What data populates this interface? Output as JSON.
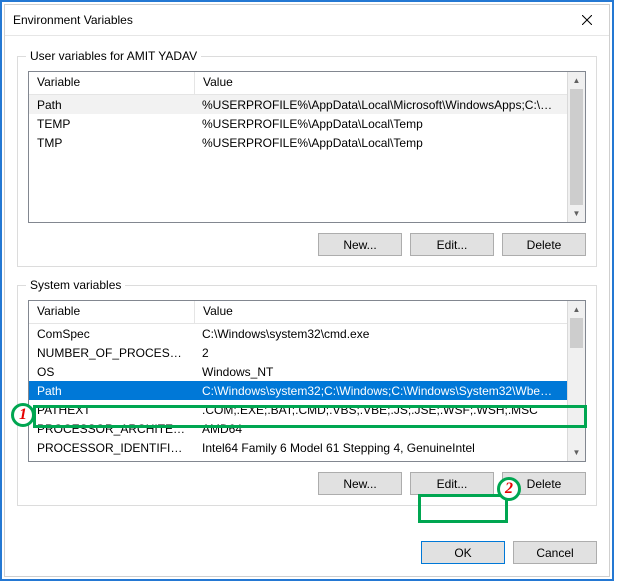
{
  "window": {
    "title": "Environment Variables"
  },
  "user_box": {
    "legend": "User variables for AMIT YADAV",
    "headers": {
      "name": "Variable",
      "value": "Value"
    },
    "rows": [
      {
        "name": "Path",
        "value": "%USERPROFILE%\\AppData\\Local\\Microsoft\\WindowsApps;C:\\Prog..."
      },
      {
        "name": "TEMP",
        "value": "%USERPROFILE%\\AppData\\Local\\Temp"
      },
      {
        "name": "TMP",
        "value": "%USERPROFILE%\\AppData\\Local\\Temp"
      }
    ],
    "buttons": {
      "new": "New...",
      "edit": "Edit...",
      "delete": "Delete"
    }
  },
  "system_box": {
    "legend": "System variables",
    "headers": {
      "name": "Variable",
      "value": "Value"
    },
    "rows": [
      {
        "name": "ComSpec",
        "value": "C:\\Windows\\system32\\cmd.exe"
      },
      {
        "name": "NUMBER_OF_PROCESSORS",
        "value": "2"
      },
      {
        "name": "OS",
        "value": "Windows_NT"
      },
      {
        "name": "Path",
        "value": "C:\\Windows\\system32;C:\\Windows;C:\\Windows\\System32\\Wbem;..."
      },
      {
        "name": "PATHEXT",
        "value": ".COM;.EXE;.BAT;.CMD;.VBS;.VBE;.JS;.JSE;.WSF;.WSH;.MSC"
      },
      {
        "name": "PROCESSOR_ARCHITECTURE",
        "value": "AMD64"
      },
      {
        "name": "PROCESSOR_IDENTIFIER",
        "value": "Intel64 Family 6 Model 61 Stepping 4, GenuineIntel"
      }
    ],
    "buttons": {
      "new": "New...",
      "edit": "Edit...",
      "delete": "Delete"
    }
  },
  "footer": {
    "ok": "OK",
    "cancel": "Cancel"
  },
  "annotations": {
    "one": "1",
    "two": "2"
  }
}
